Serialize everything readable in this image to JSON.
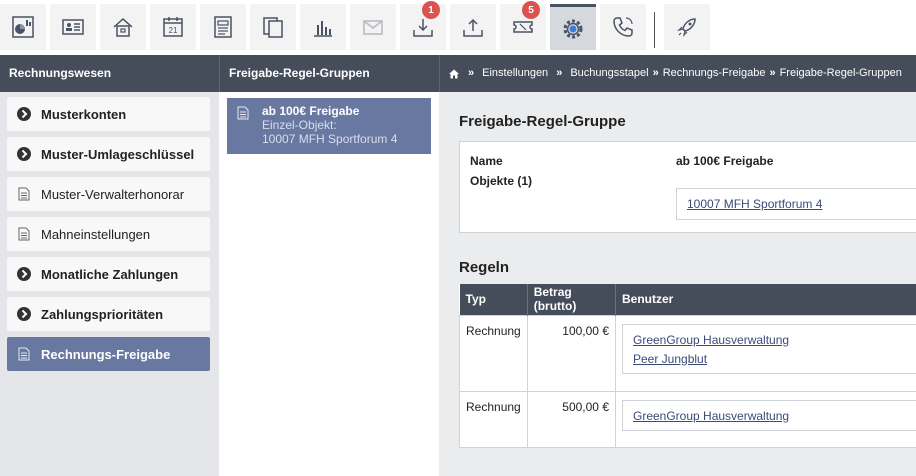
{
  "toolbar": {
    "items": [
      {
        "id": "dashboard",
        "icon": "dashboard-chart-icon"
      },
      {
        "id": "contacts",
        "icon": "contact-card-icon"
      },
      {
        "id": "properties",
        "icon": "house-icon"
      },
      {
        "id": "calendar",
        "icon": "calendar-icon",
        "text": "21"
      },
      {
        "id": "documents",
        "icon": "document-icon"
      },
      {
        "id": "copies",
        "icon": "copy-pages-icon"
      },
      {
        "id": "reports",
        "icon": "bar-chart-icon"
      },
      {
        "id": "mail",
        "icon": "envelope-icon"
      },
      {
        "id": "inbox",
        "icon": "download-tray-icon",
        "badge": "1"
      },
      {
        "id": "upload",
        "icon": "upload-tray-icon"
      },
      {
        "id": "tickets",
        "icon": "ticket-icon",
        "badge": "5"
      },
      {
        "id": "settings",
        "icon": "gear-icon",
        "active": true
      },
      {
        "id": "phone",
        "icon": "phone-icon"
      },
      {
        "id": "launch",
        "icon": "rocket-icon"
      }
    ]
  },
  "header": {
    "left_title": "Rechnungswesen",
    "middle_title": "Freigabe-Regel-Gruppen",
    "breadcrumb": [
      "Einstellungen",
      "Buchungsstapel",
      "Rechnungs-Freigabe",
      "Freigabe-Regel-Gruppen"
    ],
    "breadcrumb_sep": "»"
  },
  "sidebar": {
    "items": [
      {
        "label": "Musterkonten",
        "icon": "chevron-right-circle-icon",
        "bold": true
      },
      {
        "label": "Muster-Umlageschlüssel",
        "icon": "chevron-right-circle-icon",
        "bold": true
      },
      {
        "label": "Muster-Verwalterhonorar",
        "icon": "document-icon",
        "bold": false
      },
      {
        "label": "Mahneinstellungen",
        "icon": "document-icon",
        "bold": false
      },
      {
        "label": "Monatliche Zahlungen",
        "icon": "chevron-right-circle-icon",
        "bold": true
      },
      {
        "label": "Zahlungsprioritäten",
        "icon": "chevron-right-circle-icon",
        "bold": true
      },
      {
        "label": "Rechnungs-Freigabe",
        "icon": "document-icon",
        "bold": true,
        "active": true
      }
    ]
  },
  "groups": {
    "selected": {
      "title": "ab 100€ Freigabe",
      "subtitle": "Einzel-Objekt:",
      "object": "10007 MFH Sportforum 4"
    }
  },
  "detail": {
    "section_title": "Freigabe-Regel-Gruppe",
    "name_label": "Name",
    "name_value": "ab 100€ Freigabe",
    "objects_label": "Objekte (1)",
    "objects": [
      "10007 MFH Sportforum 4"
    ]
  },
  "rules": {
    "section_title": "Regeln",
    "columns": [
      "Typ",
      "Betrag (brutto)",
      "Benutzer"
    ],
    "rows": [
      {
        "type": "Rechnung",
        "amount": "100,00 €",
        "users": [
          "GreenGroup Hausverwaltung",
          "Peer Jungblut"
        ]
      },
      {
        "type": "Rechnung",
        "amount": "500,00 €",
        "users": [
          "GreenGroup Hausverwaltung"
        ]
      }
    ]
  },
  "colors": {
    "header_bg": "#454c5a",
    "accent": "#6878a0",
    "badge": "#d9534f",
    "sidebar_bg": "#e4e6e9",
    "main_bg": "#ebecee"
  }
}
